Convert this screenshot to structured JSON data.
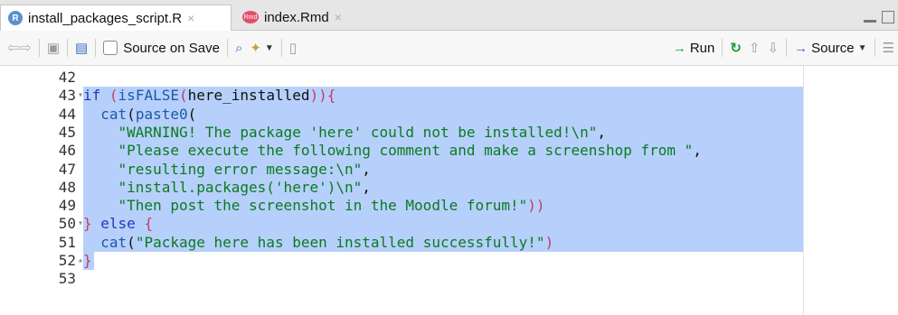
{
  "tabs": [
    {
      "label": "install_packages_script.R",
      "close": "×",
      "icon_text": "R"
    },
    {
      "label": "index.Rmd",
      "close": "×",
      "icon_text": "Rmd"
    }
  ],
  "toolbar": {
    "source_on_save": "Source on Save",
    "run": "Run",
    "source": "Source",
    "run_arrow": "→",
    "source_arrow": "→"
  },
  "editor": {
    "lines": [
      {
        "num": "42",
        "fold": "",
        "tokens": []
      },
      {
        "num": "43",
        "fold": "▾",
        "tokens": [
          {
            "t": "kw",
            "v": "if"
          },
          {
            "t": "plain",
            "v": " "
          },
          {
            "t": "paren",
            "v": "("
          },
          {
            "t": "fn",
            "v": "isFALSE"
          },
          {
            "t": "paren",
            "v": "("
          },
          {
            "t": "plain",
            "v": "here_installed"
          },
          {
            "t": "paren",
            "v": "))"
          },
          {
            "t": "paren",
            "v": "{"
          }
        ]
      },
      {
        "num": "44",
        "fold": "",
        "tokens": [
          {
            "t": "plain",
            "v": "  "
          },
          {
            "t": "fn",
            "v": "cat"
          },
          {
            "t": "plain",
            "v": "("
          },
          {
            "t": "fn",
            "v": "paste0"
          },
          {
            "t": "plain",
            "v": "("
          }
        ]
      },
      {
        "num": "45",
        "fold": "",
        "tokens": [
          {
            "t": "plain",
            "v": "    "
          },
          {
            "t": "str",
            "v": "\"WARNING! The package 'here' could not be installed!\\n\""
          },
          {
            "t": "plain",
            "v": ","
          }
        ]
      },
      {
        "num": "46",
        "fold": "",
        "tokens": [
          {
            "t": "plain",
            "v": "    "
          },
          {
            "t": "str",
            "v": "\"Please execute the following comment and make a screenshop from \""
          },
          {
            "t": "plain",
            "v": ","
          }
        ]
      },
      {
        "num": "47",
        "fold": "",
        "tokens": [
          {
            "t": "plain",
            "v": "    "
          },
          {
            "t": "str",
            "v": "\"resulting error message:\\n\""
          },
          {
            "t": "plain",
            "v": ","
          }
        ]
      },
      {
        "num": "48",
        "fold": "",
        "tokens": [
          {
            "t": "plain",
            "v": "    "
          },
          {
            "t": "str",
            "v": "\"install.packages('here')\\n\""
          },
          {
            "t": "plain",
            "v": ","
          }
        ]
      },
      {
        "num": "49",
        "fold": "",
        "tokens": [
          {
            "t": "plain",
            "v": "    "
          },
          {
            "t": "str",
            "v": "\"Then post the screenshot in the Moodle forum!\""
          },
          {
            "t": "paren",
            "v": "))"
          }
        ]
      },
      {
        "num": "50",
        "fold": "▾",
        "tokens": [
          {
            "t": "paren",
            "v": "}"
          },
          {
            "t": "plain",
            "v": " "
          },
          {
            "t": "kw",
            "v": "else"
          },
          {
            "t": "plain",
            "v": " "
          },
          {
            "t": "paren",
            "v": "{"
          }
        ]
      },
      {
        "num": "51",
        "fold": "",
        "tokens": [
          {
            "t": "plain",
            "v": "  "
          },
          {
            "t": "fn",
            "v": "cat"
          },
          {
            "t": "plain",
            "v": "("
          },
          {
            "t": "str",
            "v": "\"Package here has been installed successfully!\""
          },
          {
            "t": "paren",
            "v": ")"
          }
        ]
      },
      {
        "num": "52",
        "fold": "▴",
        "tokens": [
          {
            "t": "paren",
            "v": "}"
          }
        ]
      },
      {
        "num": "53",
        "fold": "",
        "tokens": []
      }
    ]
  },
  "colors": {
    "selection": "#b6d0fb",
    "keyword": "#2338b5",
    "string": "#0b7a20",
    "paren": "#c73a64",
    "run_green": "#1e9e38"
  }
}
